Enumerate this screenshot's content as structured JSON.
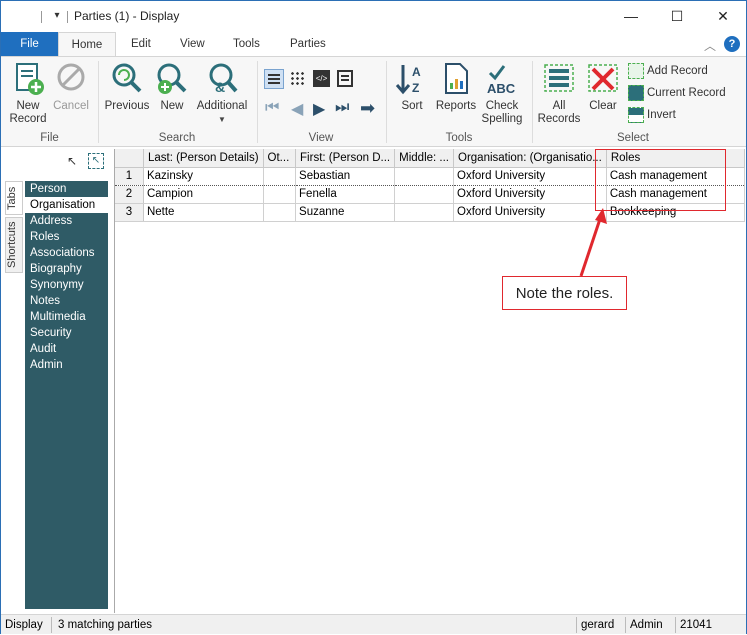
{
  "window": {
    "title": "Parties (1) - Display",
    "minimize": "—",
    "maximize": "☐",
    "close": "✕",
    "quick_access": "▾"
  },
  "ribbon_tabs": [
    "File",
    "Home",
    "Edit",
    "View",
    "Tools",
    "Parties"
  ],
  "ribbon": {
    "file_group": {
      "label": "File",
      "new_record": "New\nRecord",
      "cancel": "Cancel"
    },
    "search_group": {
      "label": "Search",
      "previous": "Previous",
      "new": "New",
      "additional": "Additional"
    },
    "view_group": {
      "label": "View"
    },
    "tools_group": {
      "label": "Tools",
      "sort": "Sort",
      "reports": "Reports",
      "check_spelling": "Check\nSpelling"
    },
    "select_group": {
      "label": "Select",
      "all_records": "All\nRecords",
      "clear": "Clear",
      "add_record": "Add Record",
      "current_record": "Current Record",
      "invert": "Invert"
    }
  },
  "side_tabs": [
    "Tabs",
    "Shortcuts"
  ],
  "nav_items": [
    "Person",
    "Organisation",
    "Address",
    "Roles",
    "Associations",
    "Biography",
    "Synonymy",
    "Notes",
    "Multimedia",
    "Security",
    "Audit",
    "Admin"
  ],
  "nav_selected_index": 1,
  "grid": {
    "columns": [
      "",
      "Last: (Person Details)",
      "Ot...",
      "First: (Person D...",
      "Middle: ...",
      "Organisation: (Organisatio...",
      "Roles"
    ],
    "rows": [
      [
        "1",
        "Kazinsky",
        "",
        "Sebastian",
        "",
        "Oxford University",
        "Cash management"
      ],
      [
        "2",
        "Campion",
        "",
        "Fenella",
        "",
        "Oxford University",
        "Cash management"
      ],
      [
        "3",
        "Nette",
        "",
        "Suzanne",
        "",
        "Oxford University",
        "Bookkeeping"
      ]
    ]
  },
  "annotation": {
    "text": "Note the roles.",
    "color": "#e0282e"
  },
  "status": {
    "mode": "Display",
    "message": "3 matching parties",
    "user": "gerard",
    "role": "Admin",
    "number": "21041"
  },
  "colors": {
    "accent": "#1f6fbf",
    "nav_bg": "#2f5b66",
    "icon_teal": "#2c6f7a",
    "icon_green": "#4caf50"
  }
}
